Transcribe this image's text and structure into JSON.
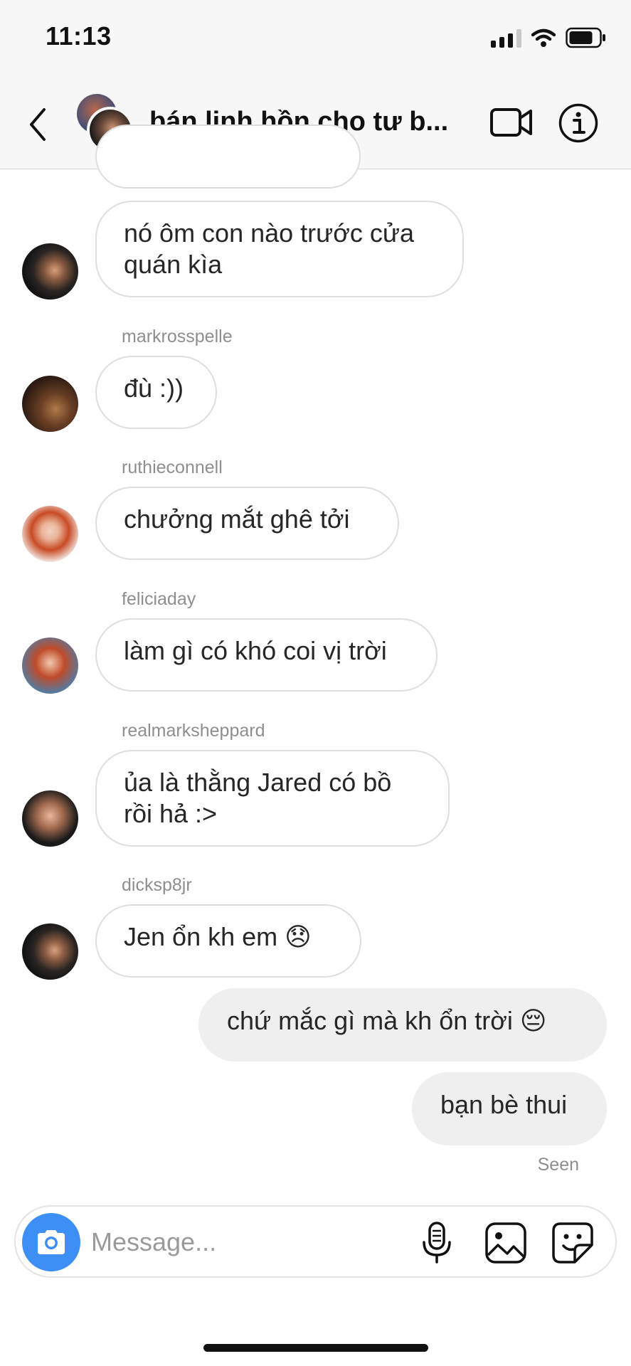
{
  "status_bar": {
    "time": "11:13"
  },
  "header": {
    "title": "bán linh hồn cho tư b..."
  },
  "messages": [
    {
      "sender": "",
      "text": "",
      "own": false
    },
    {
      "sender": "",
      "text": "nó ôm con nào trước cửa\nquán kìa",
      "own": false
    },
    {
      "sender": "markrosspelle",
      "text": "đù :))",
      "own": false
    },
    {
      "sender": "ruthieconnell",
      "text": "chưởng mắt ghê tởi",
      "own": false
    },
    {
      "sender": "feliciaday",
      "text": "làm gì có khó coi vị trời",
      "own": false
    },
    {
      "sender": "realmarksheppard",
      "text": "ủa là thằng Jared có bồ\nrồi hả :>",
      "own": false
    },
    {
      "sender": "dicksp8jr",
      "text": "Jen ổn kh em 😞",
      "own": false
    },
    {
      "sender": "",
      "text": "chứ mắc gì mà kh ổn trời 😔",
      "own": true
    },
    {
      "sender": "",
      "text": "bạn bè thui",
      "own": true
    }
  ],
  "seen_label": "Seen",
  "composer": {
    "placeholder": "Message..."
  },
  "colors": {
    "camera_button": "#3d8ff6",
    "own_bubble": "#efefef",
    "bubble_border": "#dedede",
    "secondary_text": "#8e8e8e"
  },
  "icons": [
    "back-icon",
    "video-call-icon",
    "info-icon",
    "camera-icon",
    "microphone-icon",
    "photo-gallery-icon",
    "sticker-icon"
  ]
}
